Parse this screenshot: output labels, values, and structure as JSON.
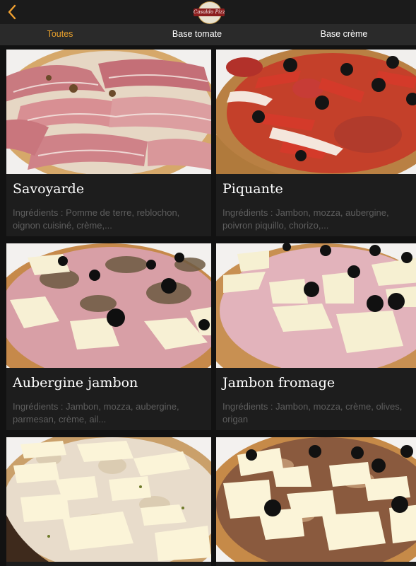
{
  "header": {
    "back_icon": "chevron-left-icon",
    "logo_text": "Casaldo Pizza",
    "accent_color": "#e8a02c"
  },
  "tabs": [
    {
      "label": "Toutes",
      "active": true
    },
    {
      "label": "Base tomate",
      "active": false
    },
    {
      "label": "Base crème",
      "active": false
    }
  ],
  "pizzas": [
    {
      "name": "Savoyarde",
      "description": "Ingrédients : Pomme de terre, reblochon, oignon cuisiné, crème,..."
    },
    {
      "name": "Piquante",
      "description": "Ingrédients : Jambon, mozza, aubergine, poivron piquillo, chorizo,..."
    },
    {
      "name": "Aubergine jambon",
      "description": "Ingrédients : Jambon, mozza, aubergine, parmesan, crème, ail..."
    },
    {
      "name": "Jambon fromage",
      "description": "Ingrédients : Jambon, mozza, crème, olives, origan"
    },
    {
      "name": "",
      "description": ""
    },
    {
      "name": "",
      "description": ""
    }
  ]
}
